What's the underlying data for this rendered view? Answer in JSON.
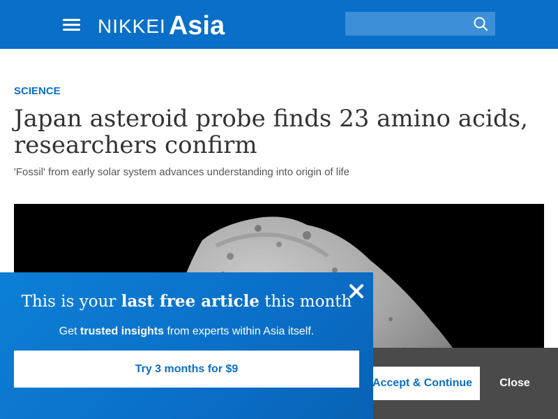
{
  "header": {
    "logo_main": "NIKKEI",
    "logo_accent": "Asia",
    "search_placeholder": "",
    "background_color": "#0a6fc8"
  },
  "article": {
    "category": "SCIENCE",
    "headline": "Japan asteroid probe finds 23 amino acids, researchers confirm",
    "subhead": "'Fossil' from early solar system advances understanding into origin of life"
  },
  "paywall": {
    "title_pre": "This is your ",
    "title_bold": "last free article",
    "title_post": " this month",
    "sub_pre": "Get ",
    "sub_bold": "trusted insights",
    "sub_post": " from experts within Asia itself.",
    "cta_label": "Try 3 months for $9",
    "close_icon": "close-x-icon"
  },
  "cookie_bar": {
    "accept_label": "Accept & Continue",
    "close_label": "Close"
  },
  "icons": {
    "menu": "hamburger-menu-icon",
    "search": "search-icon"
  }
}
